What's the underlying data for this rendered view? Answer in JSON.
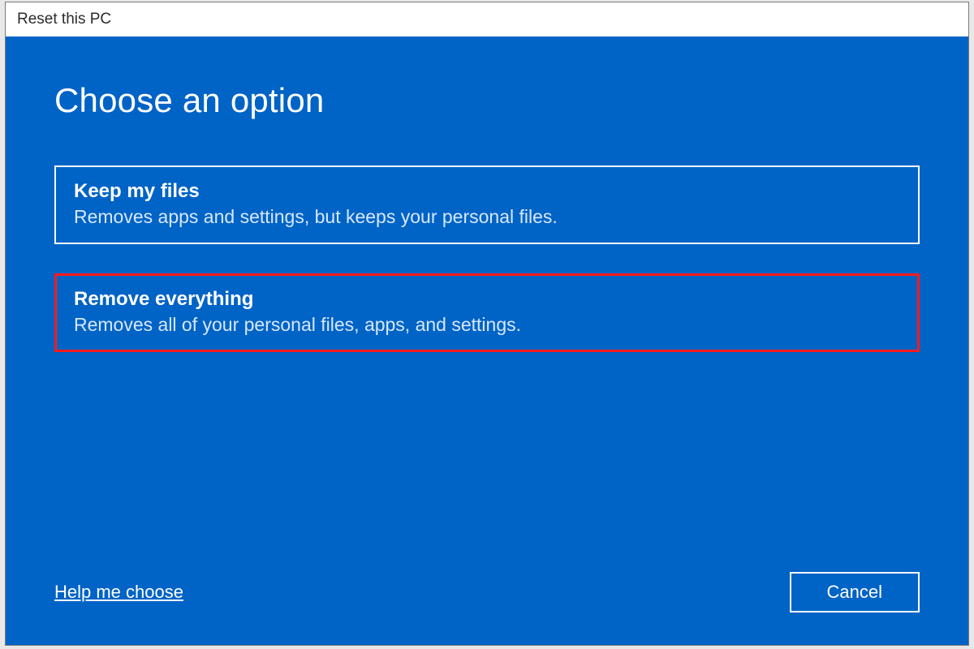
{
  "window": {
    "title": "Reset this PC"
  },
  "heading": "Choose an option",
  "options": [
    {
      "title": "Keep my files",
      "description": "Removes apps and settings, but keeps your personal files.",
      "highlighted": false
    },
    {
      "title": "Remove everything",
      "description": "Removes all of your personal files, apps, and settings.",
      "highlighted": true
    }
  ],
  "footer": {
    "help_link": "Help me choose",
    "cancel_label": "Cancel"
  }
}
